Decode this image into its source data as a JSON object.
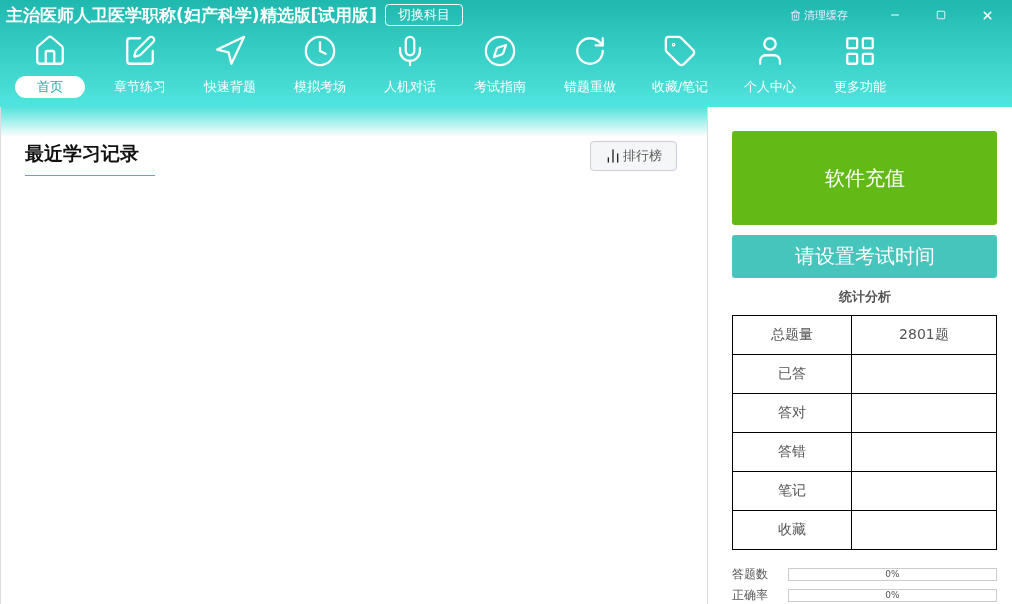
{
  "window": {
    "title": "主治医师人卫医学职称(妇产科学)精选版[试用版]",
    "switch_button": "切换科目",
    "clear_cache": "清理缓存"
  },
  "nav": [
    {
      "label": "首页",
      "selected": true
    },
    {
      "label": "章节练习",
      "selected": false
    },
    {
      "label": "快速背题",
      "selected": false
    },
    {
      "label": "模拟考场",
      "selected": false
    },
    {
      "label": "人机对话",
      "selected": false
    },
    {
      "label": "考试指南",
      "selected": false
    },
    {
      "label": "错题重做",
      "selected": false
    },
    {
      "label": "收藏/笔记",
      "selected": false
    },
    {
      "label": "个人中心",
      "selected": false
    },
    {
      "label": "更多功能",
      "selected": false
    }
  ],
  "records": {
    "title": "最近学习记录",
    "ranking_button": "排行榜"
  },
  "recharge_button": "软件充值",
  "exam_time_button": "请设置考试时间",
  "stats": {
    "title": "统计分析",
    "rows": [
      {
        "label": "总题量",
        "value": "2801题"
      },
      {
        "label": "已答"
      },
      {
        "label": "答对"
      },
      {
        "label": "答错"
      },
      {
        "label": "笔记"
      },
      {
        "label": "收藏"
      }
    ]
  },
  "progress": [
    {
      "label": "答题数",
      "reading": "0%",
      "level": 0
    },
    {
      "label": "正确率",
      "reading": "0%",
      "level": 0
    }
  ]
}
